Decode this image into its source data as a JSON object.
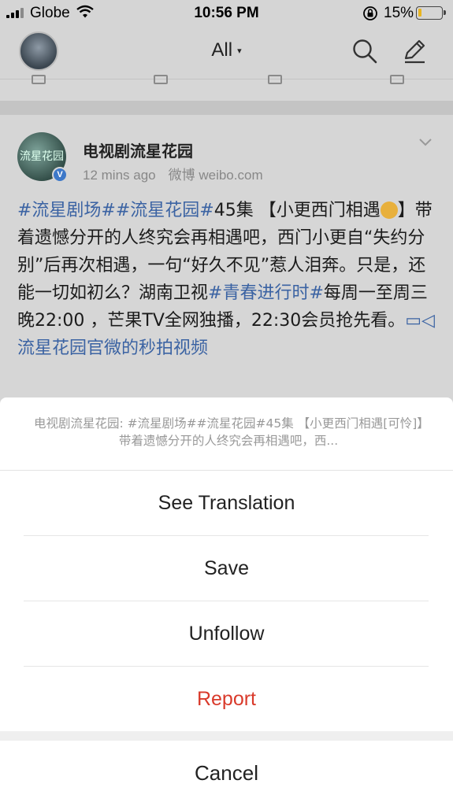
{
  "status_bar": {
    "carrier": "Globe",
    "time": "10:56 PM",
    "battery_percent": "15%",
    "battery_level": 0.15,
    "battery_color": "#e8b520"
  },
  "nav": {
    "title": "All",
    "caret": "▾",
    "icons": [
      "search-icon",
      "compose-icon"
    ]
  },
  "post": {
    "author": "电视剧流星花园",
    "avatar_text": "流星花园",
    "time_ago": "12 mins ago",
    "source": "微博 weibo.com",
    "body": [
      {
        "t": "#流星剧场##流星花园#",
        "link": true
      },
      {
        "t": "45集 【小更西门相遇",
        "link": false
      },
      {
        "t": "emoji",
        "emoji": true
      },
      {
        "t": "】带着遗憾分开的人终究会再相遇吧，西门小更自“失约分别”后再次相遇，一句“好久不见”惹人泪奔。只是，还能一切如初么？湖南卫视",
        "link": false
      },
      {
        "t": "#青春进行时#",
        "link": true
      },
      {
        "t": "每周一至周三晚22:00 ，芒果TV全网独播，22:30会员抢先看。",
        "link": false
      },
      {
        "t": "▭◁流星花园官微的秒拍视频",
        "link": true
      }
    ],
    "link_color": "#3b63a3"
  },
  "action_sheet": {
    "preview": "电视剧流星花园: #流星剧场##流星花园#45集 【小更西门相遇[可怜]】带着遗憾分开的人终究会再相遇吧，西...",
    "options": [
      {
        "label": "See Translation",
        "style": "normal"
      },
      {
        "label": "Save",
        "style": "normal"
      },
      {
        "label": "Unfollow",
        "style": "normal"
      },
      {
        "label": "Report",
        "style": "destructive"
      }
    ],
    "cancel": "Cancel",
    "destructive_color": "#d93a2b"
  }
}
